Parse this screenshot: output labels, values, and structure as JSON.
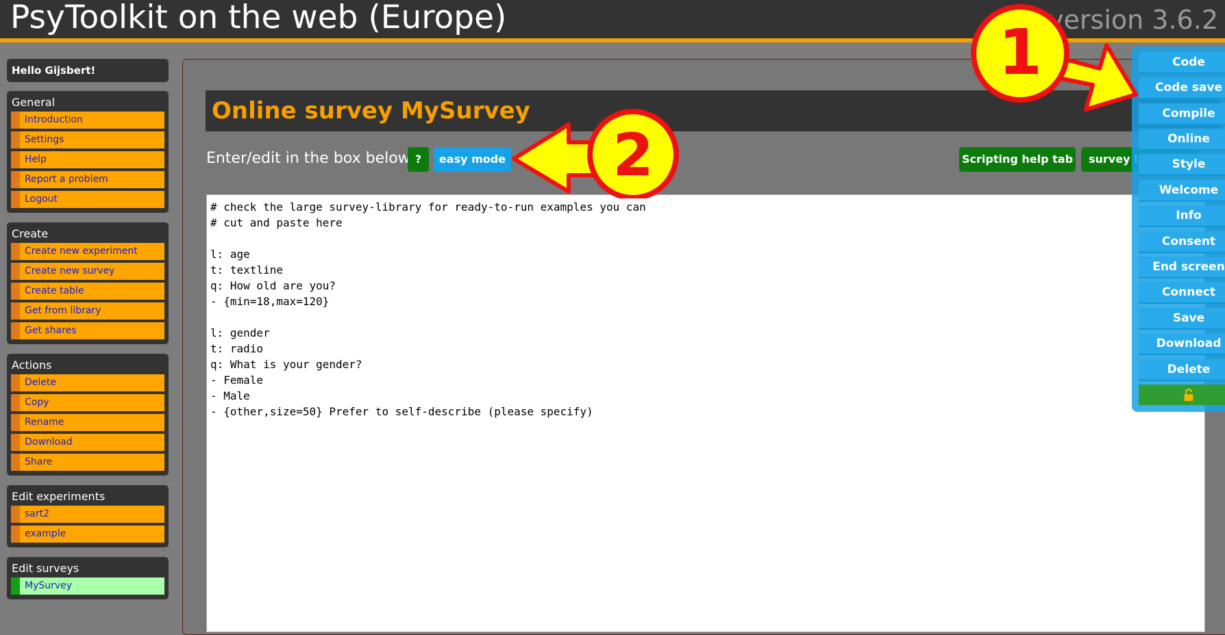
{
  "header": {
    "title": "PsyToolkit on the web (Europe)",
    "version": "version 3.6.2"
  },
  "sidebar": {
    "greeting": "Hello Gijsbert!",
    "sections": [
      {
        "heading": "General",
        "items": [
          "Introduction",
          "Settings",
          "Help",
          "Report a problem",
          "Logout"
        ]
      },
      {
        "heading": "Create",
        "items": [
          "Create new experiment",
          "Create new survey",
          "Create table",
          "Get from library",
          "Get shares"
        ]
      },
      {
        "heading": "Actions",
        "items": [
          "Delete",
          "Copy",
          "Rename",
          "Download",
          "Share"
        ]
      },
      {
        "heading": "Edit experiments",
        "items": [
          "sart2",
          "example"
        ]
      },
      {
        "heading": "Edit surveys",
        "items": [
          "MySurvey"
        ],
        "active_item": "MySurvey"
      }
    ]
  },
  "main": {
    "title": "Online survey MySurvey",
    "enter_label": "Enter/edit in the box below:",
    "help_button": "?",
    "easy_mode_button": "easy mode",
    "scripting_help_button": "Scripting help tab",
    "survey_library_button": "survey library tab",
    "editor_text": "# check the large survey-library for ready-to-run examples you can\n# cut and paste here\n\nl: age\nt: textline\nq: How old are you?\n- {min=18,max=120}\n\nl: gender\nt: radio\nq: What is your gender?\n- Female\n- Male\n- {other,size=50} Prefer to self-describe (please specify)"
  },
  "right_menu": {
    "items": [
      "Code",
      "Code save",
      "Compile",
      "Online",
      "Style",
      "Welcome",
      "Info",
      "Consent",
      "End screen",
      "Connect",
      "Save",
      "Download",
      "Delete"
    ],
    "lock_icon": "lock-icon"
  },
  "annotations": {
    "callout_1": "1",
    "callout_2": "2",
    "callout_color": "#ffff00",
    "callout_outline": "#ee1111"
  },
  "colors": {
    "header_bg": "#333333",
    "accent_orange": "#f5a000",
    "menu_item_bg": "#ffa500",
    "active_item_bg": "#aaffaa",
    "button_green": "#0c7a0c",
    "button_blue": "#17a2e8"
  }
}
